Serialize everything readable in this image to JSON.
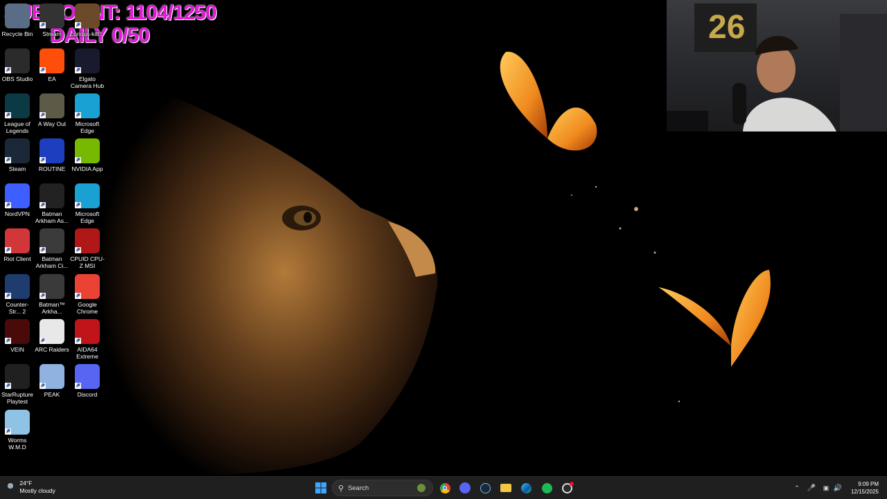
{
  "overlay": {
    "sub_count": "SUBCOUNT: 1104/1250",
    "daily": "DAILY 0/50"
  },
  "desktop": {
    "icons": [
      {
        "label": "Recycle Bin",
        "icon": "recycle-bin-icon",
        "color": "#5a6d86"
      },
      {
        "label": "Stream",
        "icon": "stream-icon",
        "color": "#333333"
      },
      {
        "label": "curious-kitt...",
        "icon": "image-file-icon",
        "color": "#6b4a2a"
      },
      {
        "label": "OBS Studio",
        "icon": "obs-icon",
        "color": "#2b2b2b"
      },
      {
        "label": "EA",
        "icon": "ea-icon",
        "color": "#ff4d0a"
      },
      {
        "label": "Elgato Camera Hub",
        "icon": "elgato-icon",
        "color": "#1a1a2e"
      },
      {
        "label": "League of Legends",
        "icon": "league-icon",
        "color": "#0a3a44"
      },
      {
        "label": "A Way Out",
        "icon": "a-way-out-icon",
        "color": "#5d5a48"
      },
      {
        "label": "Microsoft Edge",
        "icon": "edge-icon",
        "color": "#1aa1d4"
      },
      {
        "label": "Steam",
        "icon": "steam-icon",
        "color": "#1b2838"
      },
      {
        "label": "ROUTINE",
        "icon": "routine-icon",
        "color": "#1d3fbf"
      },
      {
        "label": "NVIDIA App",
        "icon": "nvidia-icon",
        "color": "#76b900"
      },
      {
        "label": "NordVPN",
        "icon": "nordvpn-icon",
        "color": "#3e5fff"
      },
      {
        "label": "Batman Arkham As...",
        "icon": "batman-icon",
        "color": "#222222"
      },
      {
        "label": "Microsoft Edge",
        "icon": "edge-icon",
        "color": "#1aa1d4"
      },
      {
        "label": "Riot Client",
        "icon": "riot-icon",
        "color": "#d13639"
      },
      {
        "label": "Batman Arkham Ci...",
        "icon": "batman-icon",
        "color": "#3b3b3b"
      },
      {
        "label": "CPUID CPU-Z MSI",
        "icon": "cpuz-icon",
        "color": "#b01818"
      },
      {
        "label": "Counter-Str... 2",
        "icon": "cs2-icon",
        "color": "#1e3c6e"
      },
      {
        "label": "Batman™ Arkha...",
        "icon": "batman-icon",
        "color": "#3a3a3a"
      },
      {
        "label": "Google Chrome",
        "icon": "chrome-icon",
        "color": "#ea4335"
      },
      {
        "label": "VEIN",
        "icon": "vein-icon",
        "color": "#4a0a0a"
      },
      {
        "label": "ARC Raiders",
        "icon": "arc-raiders-icon",
        "color": "#e8e8e8"
      },
      {
        "label": "AIDA64 Extreme",
        "icon": "aida64-icon",
        "color": "#c0141b"
      },
      {
        "label": "StarRupture Playtest",
        "icon": "starrupture-icon",
        "color": "#202020"
      },
      {
        "label": "PEAK",
        "icon": "peak-icon",
        "color": "#8fb2e0"
      },
      {
        "label": "Discord",
        "icon": "discord-icon",
        "color": "#5865f2"
      },
      {
        "label": "Worms W.M.D",
        "icon": "worms-icon",
        "color": "#8fc3e6"
      }
    ]
  },
  "taskbar": {
    "weather_temp": "24°F",
    "weather_desc": "Mostly cloudy",
    "search_placeholder": "Search",
    "time": "9:09 PM",
    "date": "12/15/2025"
  }
}
